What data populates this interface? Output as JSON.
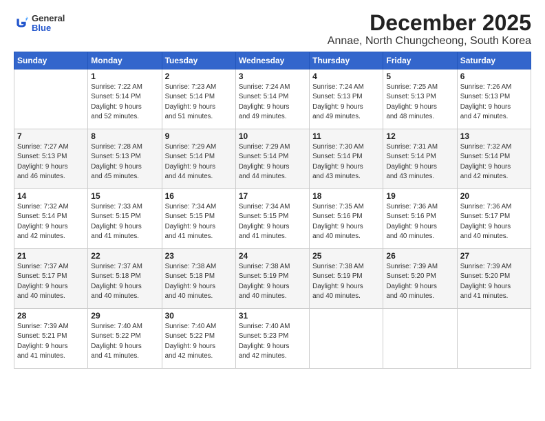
{
  "header": {
    "logo_general": "General",
    "logo_blue": "Blue",
    "title": "December 2025",
    "subtitle": "Annae, North Chungcheong, South Korea"
  },
  "weekdays": [
    "Sunday",
    "Monday",
    "Tuesday",
    "Wednesday",
    "Thursday",
    "Friday",
    "Saturday"
  ],
  "weeks": [
    [
      {
        "day": "",
        "info": ""
      },
      {
        "day": "1",
        "info": "Sunrise: 7:22 AM\nSunset: 5:14 PM\nDaylight: 9 hours\nand 52 minutes."
      },
      {
        "day": "2",
        "info": "Sunrise: 7:23 AM\nSunset: 5:14 PM\nDaylight: 9 hours\nand 51 minutes."
      },
      {
        "day": "3",
        "info": "Sunrise: 7:24 AM\nSunset: 5:14 PM\nDaylight: 9 hours\nand 49 minutes."
      },
      {
        "day": "4",
        "info": "Sunrise: 7:24 AM\nSunset: 5:13 PM\nDaylight: 9 hours\nand 49 minutes."
      },
      {
        "day": "5",
        "info": "Sunrise: 7:25 AM\nSunset: 5:13 PM\nDaylight: 9 hours\nand 48 minutes."
      },
      {
        "day": "6",
        "info": "Sunrise: 7:26 AM\nSunset: 5:13 PM\nDaylight: 9 hours\nand 47 minutes."
      }
    ],
    [
      {
        "day": "7",
        "info": "Sunrise: 7:27 AM\nSunset: 5:13 PM\nDaylight: 9 hours\nand 46 minutes."
      },
      {
        "day": "8",
        "info": "Sunrise: 7:28 AM\nSunset: 5:13 PM\nDaylight: 9 hours\nand 45 minutes."
      },
      {
        "day": "9",
        "info": "Sunrise: 7:29 AM\nSunset: 5:14 PM\nDaylight: 9 hours\nand 44 minutes."
      },
      {
        "day": "10",
        "info": "Sunrise: 7:29 AM\nSunset: 5:14 PM\nDaylight: 9 hours\nand 44 minutes."
      },
      {
        "day": "11",
        "info": "Sunrise: 7:30 AM\nSunset: 5:14 PM\nDaylight: 9 hours\nand 43 minutes."
      },
      {
        "day": "12",
        "info": "Sunrise: 7:31 AM\nSunset: 5:14 PM\nDaylight: 9 hours\nand 43 minutes."
      },
      {
        "day": "13",
        "info": "Sunrise: 7:32 AM\nSunset: 5:14 PM\nDaylight: 9 hours\nand 42 minutes."
      }
    ],
    [
      {
        "day": "14",
        "info": "Sunrise: 7:32 AM\nSunset: 5:14 PM\nDaylight: 9 hours\nand 42 minutes."
      },
      {
        "day": "15",
        "info": "Sunrise: 7:33 AM\nSunset: 5:15 PM\nDaylight: 9 hours\nand 41 minutes."
      },
      {
        "day": "16",
        "info": "Sunrise: 7:34 AM\nSunset: 5:15 PM\nDaylight: 9 hours\nand 41 minutes."
      },
      {
        "day": "17",
        "info": "Sunrise: 7:34 AM\nSunset: 5:15 PM\nDaylight: 9 hours\nand 41 minutes."
      },
      {
        "day": "18",
        "info": "Sunrise: 7:35 AM\nSunset: 5:16 PM\nDaylight: 9 hours\nand 40 minutes."
      },
      {
        "day": "19",
        "info": "Sunrise: 7:36 AM\nSunset: 5:16 PM\nDaylight: 9 hours\nand 40 minutes."
      },
      {
        "day": "20",
        "info": "Sunrise: 7:36 AM\nSunset: 5:17 PM\nDaylight: 9 hours\nand 40 minutes."
      }
    ],
    [
      {
        "day": "21",
        "info": "Sunrise: 7:37 AM\nSunset: 5:17 PM\nDaylight: 9 hours\nand 40 minutes."
      },
      {
        "day": "22",
        "info": "Sunrise: 7:37 AM\nSunset: 5:18 PM\nDaylight: 9 hours\nand 40 minutes."
      },
      {
        "day": "23",
        "info": "Sunrise: 7:38 AM\nSunset: 5:18 PM\nDaylight: 9 hours\nand 40 minutes."
      },
      {
        "day": "24",
        "info": "Sunrise: 7:38 AM\nSunset: 5:19 PM\nDaylight: 9 hours\nand 40 minutes."
      },
      {
        "day": "25",
        "info": "Sunrise: 7:38 AM\nSunset: 5:19 PM\nDaylight: 9 hours\nand 40 minutes."
      },
      {
        "day": "26",
        "info": "Sunrise: 7:39 AM\nSunset: 5:20 PM\nDaylight: 9 hours\nand 40 minutes."
      },
      {
        "day": "27",
        "info": "Sunrise: 7:39 AM\nSunset: 5:20 PM\nDaylight: 9 hours\nand 41 minutes."
      }
    ],
    [
      {
        "day": "28",
        "info": "Sunrise: 7:39 AM\nSunset: 5:21 PM\nDaylight: 9 hours\nand 41 minutes."
      },
      {
        "day": "29",
        "info": "Sunrise: 7:40 AM\nSunset: 5:22 PM\nDaylight: 9 hours\nand 41 minutes."
      },
      {
        "day": "30",
        "info": "Sunrise: 7:40 AM\nSunset: 5:22 PM\nDaylight: 9 hours\nand 42 minutes."
      },
      {
        "day": "31",
        "info": "Sunrise: 7:40 AM\nSunset: 5:23 PM\nDaylight: 9 hours\nand 42 minutes."
      },
      {
        "day": "",
        "info": ""
      },
      {
        "day": "",
        "info": ""
      },
      {
        "day": "",
        "info": ""
      }
    ]
  ]
}
